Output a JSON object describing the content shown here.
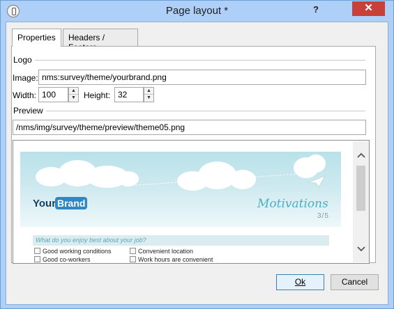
{
  "window": {
    "title": "Page layout *",
    "help_label": "?",
    "close_label": "✕"
  },
  "tabs": [
    {
      "label": "Properties",
      "active": true
    },
    {
      "label": "Headers / Footers",
      "active": false
    }
  ],
  "logo_section": {
    "group_label": "Logo",
    "image_label": "Image:",
    "image_value": "nms:survey/theme/yourbrand.png",
    "width_label": "Width:",
    "width_value": "100",
    "height_label": "Height:",
    "height_value": "32"
  },
  "preview_section": {
    "group_label": "Preview",
    "path_value": "/nms/img/survey/theme/preview/theme05.png"
  },
  "preview_image": {
    "logo_your": "Your",
    "logo_brand": "Brand",
    "heading": "Motivations",
    "page_count": "3/5",
    "question": "What do you enjoy best about your job?",
    "options": [
      "Good working conditions",
      "Convenient location",
      "Good co-workers",
      "Work hours are convenient"
    ]
  },
  "scrollbar": {
    "up_icon": "chevron-up-icon",
    "down_icon": "chevron-down-icon"
  },
  "footer": {
    "ok_label": "Ok",
    "cancel_label": "Cancel"
  },
  "colors": {
    "titlebar": "#aecff7",
    "close_button": "#c7413a",
    "preview_accent": "#49b1c4"
  }
}
